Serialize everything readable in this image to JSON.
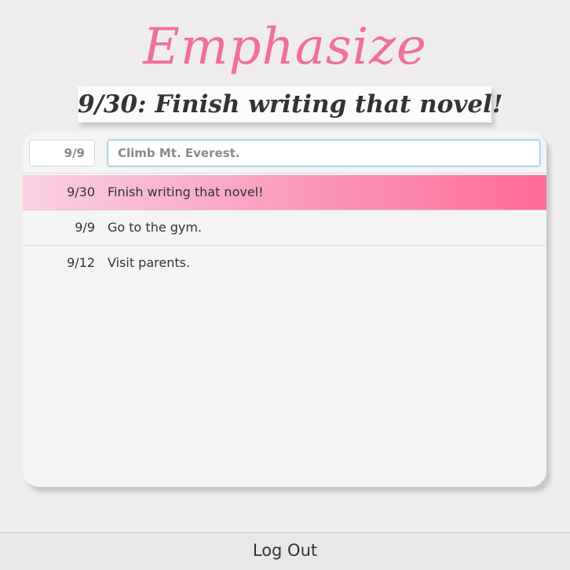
{
  "app": {
    "title": "Emphasize"
  },
  "emphasis": {
    "text": "9/30: Finish writing that novel!"
  },
  "new_task": {
    "date_placeholder": "9/9",
    "text_placeholder": "Climb Mt. Everest."
  },
  "tasks": [
    {
      "date": "9/30",
      "text": "Finish writing that novel!",
      "selected": true
    },
    {
      "date": "9/9",
      "text": "Go to the gym.",
      "selected": false
    },
    {
      "date": "9/12",
      "text": "Visit parents.",
      "selected": false
    }
  ],
  "footer": {
    "logout_label": "Log Out"
  },
  "colors": {
    "brand_pink": "#f0709a",
    "selected_gradient_start": "#fbd1e4",
    "selected_gradient_end": "#ff6b97"
  }
}
